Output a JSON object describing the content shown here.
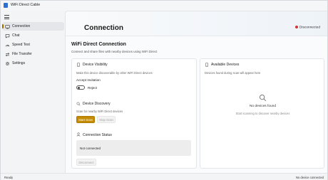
{
  "app": {
    "title": "WiFi Direct Cable",
    "accent_color": "#c58b00"
  },
  "sidebar": {
    "menu_icon": "hamburger-menu-icon",
    "items": [
      {
        "label": "Connection",
        "icon": "connection-icon",
        "active": true
      },
      {
        "label": "Chat",
        "icon": "chat-icon",
        "active": false
      },
      {
        "label": "Speed Test",
        "icon": "speed-test-icon",
        "active": false
      },
      {
        "label": "File Transfer",
        "icon": "file-transfer-icon",
        "active": false
      },
      {
        "label": "Settings",
        "icon": "gear-icon",
        "active": false
      }
    ]
  },
  "header": {
    "title": "Connection",
    "status": "Disconnected",
    "status_color": "#d13438"
  },
  "main": {
    "section_title": "WiFi Direct Connection",
    "section_subtitle": "Connect and share files with nearby devices using WiFi Direct"
  },
  "visibility": {
    "title": "Device Visibility",
    "description": "Make this device discoverable by other WiFi Direct devices",
    "accept_label": "Accept Invitation",
    "toggle_label": "Reject",
    "toggle_on": false
  },
  "discovery": {
    "title": "Device Discovery",
    "description": "Scan for nearby WiFi Direct devices",
    "start_label": "Start Scan",
    "stop_label": "Stop Scan"
  },
  "connection_status": {
    "title": "Connection Status",
    "value": "Not connected",
    "disconnect_label": "Disconnect"
  },
  "available": {
    "title": "Available Devices",
    "description": "Devices found during scan will appear here",
    "empty_title": "No devices found",
    "empty_hint": "Start scanning to discover nearby devices"
  },
  "statusbar": {
    "left": "Ready",
    "right": "No device connected"
  }
}
